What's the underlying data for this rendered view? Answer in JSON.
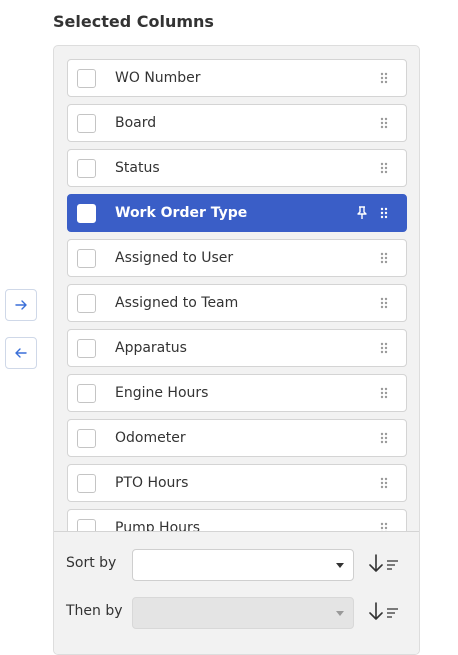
{
  "panel": {
    "title": "Selected Columns",
    "move_right_icon": "arrow-right-icon",
    "move_left_icon": "arrow-left-icon"
  },
  "columns": [
    {
      "label": "WO Number",
      "selected": false,
      "pinned": false
    },
    {
      "label": "Board",
      "selected": false,
      "pinned": false
    },
    {
      "label": "Status",
      "selected": false,
      "pinned": false
    },
    {
      "label": "Work Order Type",
      "selected": true,
      "pinned": true
    },
    {
      "label": "Assigned to User",
      "selected": false,
      "pinned": false
    },
    {
      "label": "Assigned to Team",
      "selected": false,
      "pinned": false
    },
    {
      "label": "Apparatus",
      "selected": false,
      "pinned": false
    },
    {
      "label": "Engine Hours",
      "selected": false,
      "pinned": false
    },
    {
      "label": "Odometer",
      "selected": false,
      "pinned": false
    },
    {
      "label": "PTO Hours",
      "selected": false,
      "pinned": false
    },
    {
      "label": "Pump Hours",
      "selected": false,
      "pinned": false
    }
  ],
  "sorting": {
    "sort_by_label": "Sort by",
    "sort_by_value": "",
    "then_by_label": "Then by",
    "then_by_value": "",
    "then_by_disabled": true,
    "sort_direction_icon": "sort-descending-icon"
  },
  "colors": {
    "accent": "#3a5ec7",
    "panel_bg": "#f2f2f2",
    "border": "#d4d4d4"
  }
}
